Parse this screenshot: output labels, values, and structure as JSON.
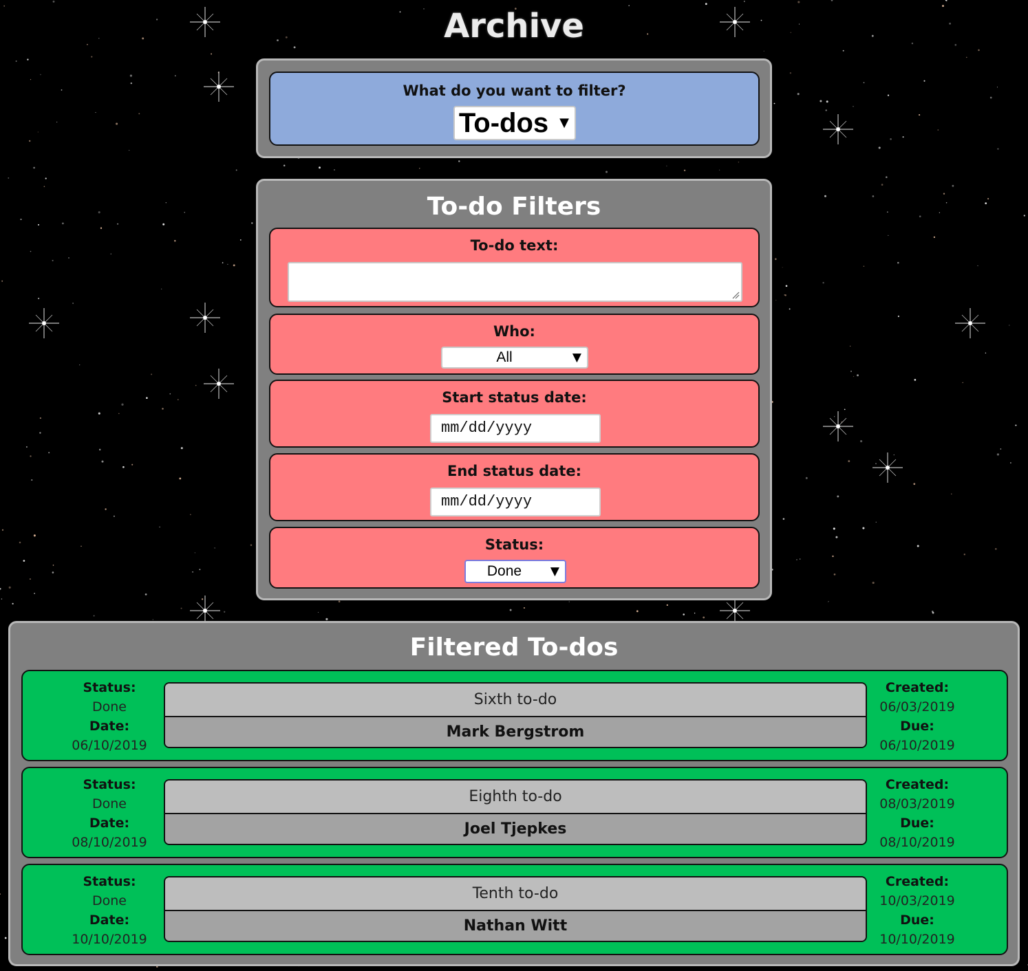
{
  "page": {
    "title": "Archive"
  },
  "filter_type": {
    "label": "What do you want to filter?",
    "selected": "To-dos"
  },
  "todo_filters": {
    "title": "To-do Filters",
    "text": {
      "label": "To-do text:",
      "value": ""
    },
    "who": {
      "label": "Who:",
      "selected": "All"
    },
    "start_date": {
      "label": "Start status date:",
      "placeholder": "mm/dd/yyyy"
    },
    "end_date": {
      "label": "End status date:",
      "placeholder": "mm/dd/yyyy"
    },
    "status": {
      "label": "Status:",
      "selected": "Done"
    }
  },
  "results": {
    "title": "Filtered To-dos",
    "status_label": "Status:",
    "date_label": "Date:",
    "created_label": "Created:",
    "due_label": "Due:",
    "items": [
      {
        "status": "Done",
        "date": "06/10/2019",
        "text": "Sixth to-do",
        "who": "Mark Bergstrom",
        "created": "06/03/2019",
        "due": "06/10/2019"
      },
      {
        "status": "Done",
        "date": "08/10/2019",
        "text": "Eighth to-do",
        "who": "Joel Tjepkes",
        "created": "08/03/2019",
        "due": "08/10/2019"
      },
      {
        "status": "Done",
        "date": "10/10/2019",
        "text": "Tenth to-do",
        "who": "Nathan Witt",
        "created": "10/03/2019",
        "due": "10/10/2019"
      }
    ]
  },
  "colors": {
    "panel": "#808080",
    "filter_type_card": "#8eaadb",
    "filter_card": "#ff7b7f",
    "result_card": "#00c058",
    "todo_text_bg": "#bdbdbd",
    "todo_who_bg": "#a3a3a3"
  },
  "icons": {
    "dropdown": "triangle-down",
    "textarea_resize": "resize-grip"
  }
}
